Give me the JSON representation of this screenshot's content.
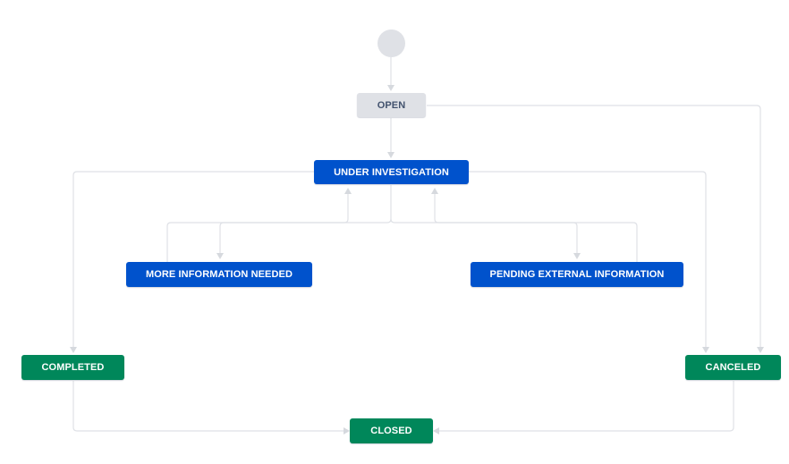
{
  "diagram": {
    "statuses": {
      "open": "OPEN",
      "under_investigation": "UNDER INVESTIGATION",
      "more_information_needed": "MORE INFORMATION NEEDED",
      "pending_external_information": "PENDING EXTERNAL INFORMATION",
      "completed": "COMPLETED",
      "canceled": "CANCELED",
      "closed": "CLOSED"
    },
    "colors": {
      "todo": "#dfe1e6",
      "todo_text": "#42526e",
      "in_progress": "#0052cc",
      "done": "#00875a",
      "connector": "#dfe1e6"
    }
  }
}
